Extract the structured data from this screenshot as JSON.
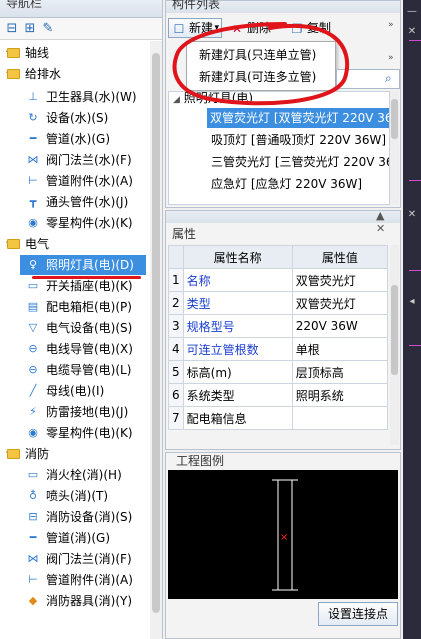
{
  "nav": {
    "title": "导航栏",
    "categories": [
      {
        "label": "轴线"
      },
      {
        "label": "给排水"
      },
      {
        "label": "电气"
      },
      {
        "label": "消防"
      }
    ],
    "items": [
      {
        "label": "卫生器具(水)(W)",
        "icon": "sanitary-icon"
      },
      {
        "label": "设备(水)(S)",
        "icon": "equipment-icon"
      },
      {
        "label": "管道(水)(G)",
        "icon": "pipe-icon"
      },
      {
        "label": "阀门法兰(水)(F)",
        "icon": "valve-icon"
      },
      {
        "label": "管道附件(水)(A)",
        "icon": "pipe-fitting-icon"
      },
      {
        "label": "通头管件(水)(J)",
        "icon": "tee-icon"
      },
      {
        "label": "零星构件(水)(K)",
        "icon": "misc-icon"
      },
      {
        "label": "照明灯具(电)(D)",
        "icon": "lamp-icon"
      },
      {
        "label": "开关插座(电)(K)",
        "icon": "switch-icon"
      },
      {
        "label": "配电箱柜(电)(P)",
        "icon": "panel-icon"
      },
      {
        "label": "电气设备(电)(S)",
        "icon": "electric-device-icon"
      },
      {
        "label": "电线导管(电)(X)",
        "icon": "wire-icon"
      },
      {
        "label": "电缆导管(电)(L)",
        "icon": "cable-icon"
      },
      {
        "label": "母线(电)(I)",
        "icon": "busbar-icon"
      },
      {
        "label": "防雷接地(电)(J)",
        "icon": "lightning-icon"
      },
      {
        "label": "零星构件(电)(K)",
        "icon": "misc-icon"
      },
      {
        "label": "消火栓(消)(H)",
        "icon": "hydrant-icon"
      },
      {
        "label": "喷头(消)(T)",
        "icon": "sprinkler-icon"
      },
      {
        "label": "消防设备(消)(S)",
        "icon": "fire-equipment-icon"
      },
      {
        "label": "管道(消)(G)",
        "icon": "pipe-icon"
      },
      {
        "label": "阀门法兰(消)(F)",
        "icon": "valve-icon"
      },
      {
        "label": "管道附件(消)(A)",
        "icon": "pipe-fitting-icon"
      },
      {
        "label": "消防器具(消)(Y)",
        "icon": "fire-tool-icon"
      }
    ]
  },
  "components": {
    "title": "构件列表",
    "new_label": "新建",
    "delete_label": "删除",
    "copy_label": "复制",
    "menu": [
      "新建灯具(只连单立管)",
      "新建灯具(可连多立管)"
    ],
    "group": "照明灯具(电)",
    "list": [
      "双管荧光灯 [双管荧光灯 220V 36",
      "吸顶灯 [普通吸顶灯 220V 36W]",
      "三管荧光灯 [三管荧光灯 220V 36",
      "应急灯 [应急灯 220V 36W]"
    ]
  },
  "properties": {
    "title": "属性",
    "col_name": "属性名称",
    "col_value": "属性值",
    "rows": [
      {
        "idx": "1",
        "name": "名称",
        "value": "双管荧光灯"
      },
      {
        "idx": "2",
        "name": "类型",
        "value": "双管荧光灯"
      },
      {
        "idx": "3",
        "name": "规格型号",
        "value": "220V 36W"
      },
      {
        "idx": "4",
        "name": "可连立管根数",
        "value": "单根"
      },
      {
        "idx": "5",
        "name": "标高(m)",
        "value": "层顶标高"
      },
      {
        "idx": "6",
        "name": "系统类型",
        "value": "照明系统"
      },
      {
        "idx": "7",
        "name": "配电箱信息",
        "value": ""
      }
    ]
  },
  "diagram": {
    "title": "工程图例",
    "set_point_label": "设置连接点"
  },
  "colors": {
    "selection": "#3c8fe0",
    "annotation": "#e0141b",
    "link_blue": "#1a3fd1"
  }
}
